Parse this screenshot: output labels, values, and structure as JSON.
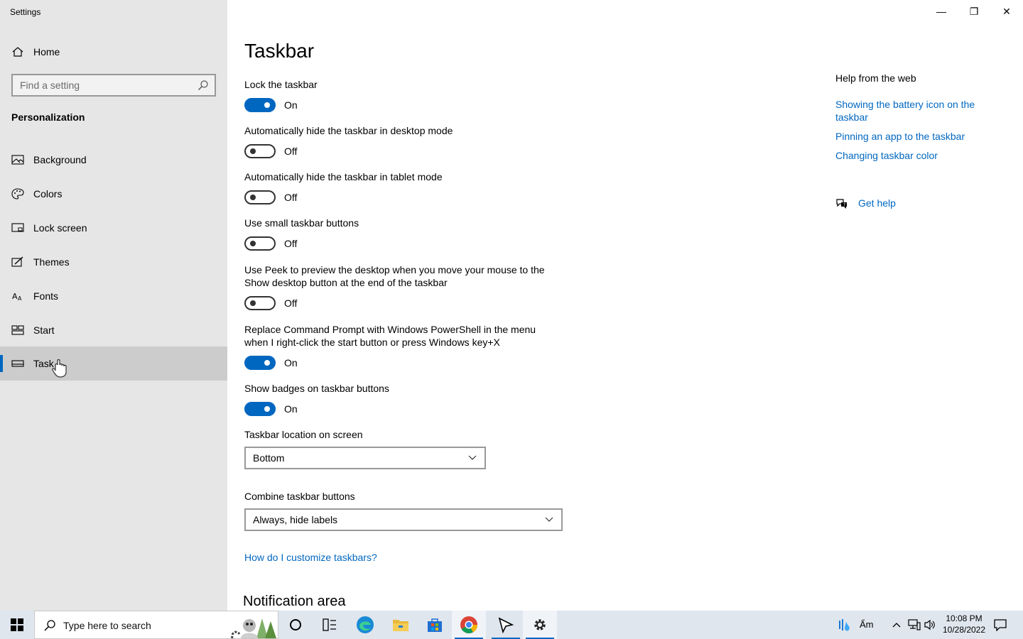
{
  "window": {
    "title": "Settings",
    "minimize_glyph": "—",
    "maximize_glyph": "❐",
    "close_glyph": "✕"
  },
  "sidebar": {
    "home_label": "Home",
    "search_placeholder": "Find a setting",
    "section_title": "Personalization",
    "items": [
      {
        "label": "Background",
        "icon": "picture-icon"
      },
      {
        "label": "Colors",
        "icon": "palette-icon"
      },
      {
        "label": "Lock screen",
        "icon": "lock-screen-icon"
      },
      {
        "label": "Themes",
        "icon": "themes-icon"
      },
      {
        "label": "Fonts",
        "icon": "fonts-icon"
      },
      {
        "label": "Start",
        "icon": "start-icon"
      },
      {
        "label": "Task",
        "icon": "taskbar-icon",
        "active": true
      }
    ]
  },
  "main": {
    "title": "Taskbar",
    "settings": [
      {
        "label": "Lock the taskbar",
        "state": "On"
      },
      {
        "label": "Automatically hide the taskbar in desktop mode",
        "state": "Off"
      },
      {
        "label": "Automatically hide the taskbar in tablet mode",
        "state": "Off"
      },
      {
        "label": "Use small taskbar buttons",
        "state": "Off"
      },
      {
        "label": "Use Peek to preview the desktop when you move your mouse to the Show desktop button at the end of the taskbar",
        "state": "Off"
      },
      {
        "label": "Replace Command Prompt with Windows PowerShell in the menu when I right-click the start button or press Windows key+X",
        "state": "On"
      },
      {
        "label": "Show badges on taskbar buttons",
        "state": "On"
      }
    ],
    "location_label": "Taskbar location on screen",
    "location_value": "Bottom",
    "combine_label": "Combine taskbar buttons",
    "combine_value": "Always, hide labels",
    "customize_link": "How do I customize taskbars?",
    "notification_title": "Notification area"
  },
  "help": {
    "title": "Help from the web",
    "links": [
      "Showing the battery icon on the taskbar",
      "Pinning an app to the taskbar",
      "Changing taskbar color"
    ],
    "get_help": "Get help"
  },
  "taskbar": {
    "search_text": "Type here to search",
    "weather_text": "Ẩm",
    "time": "10:08 PM",
    "date": "10/28/2022",
    "accent": "#0067c0"
  }
}
